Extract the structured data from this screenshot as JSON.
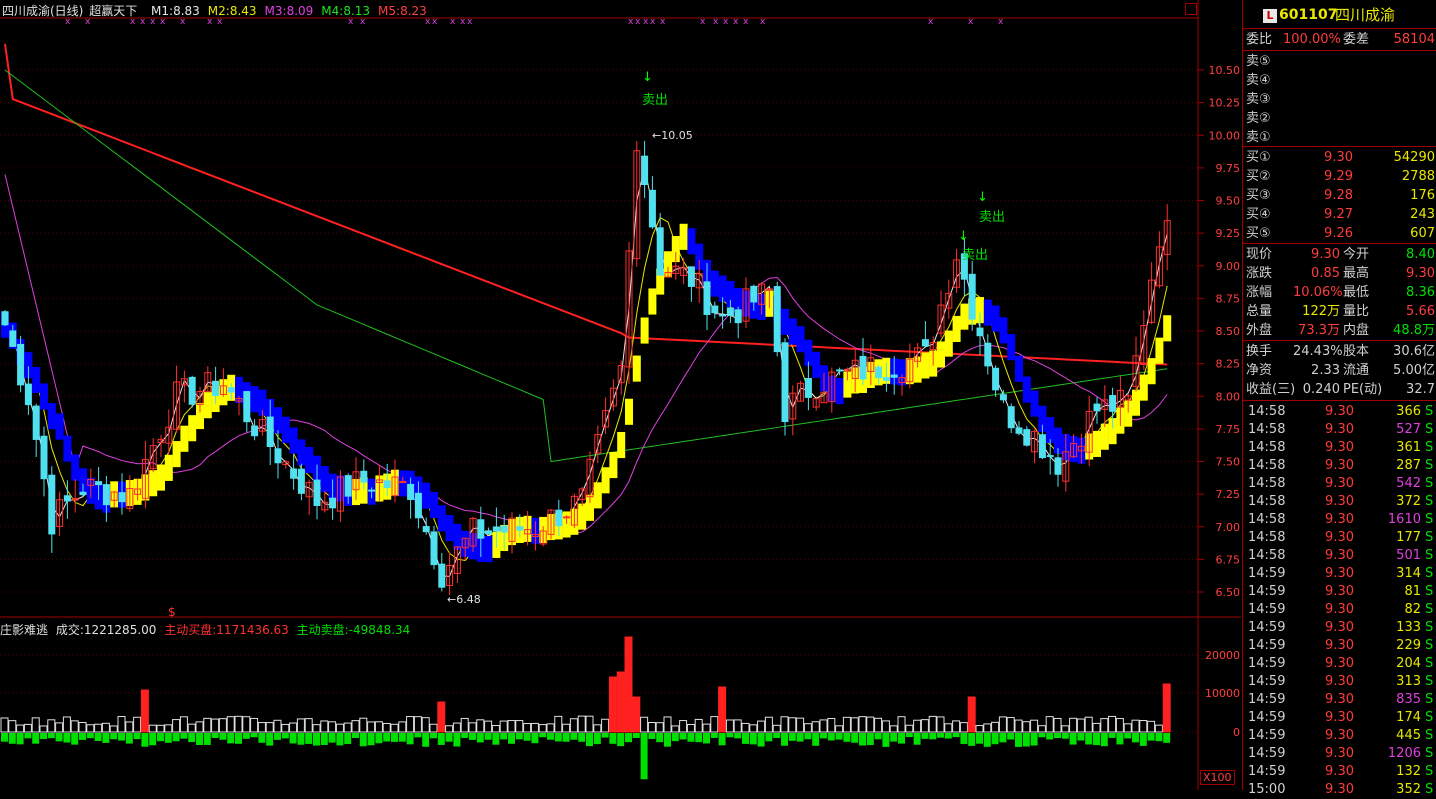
{
  "header": {
    "title": "四川成渝(日线)",
    "indicator": "超赢天下",
    "ma": [
      {
        "label": "M1:8.83",
        "color": "#e8e8e8"
      },
      {
        "label": "M2:8.43",
        "color": "#e8e800"
      },
      {
        "label": "M3:8.09",
        "color": "#e040e0"
      },
      {
        "label": "M4:8.13",
        "color": "#20e020"
      },
      {
        "label": "M5:8.23",
        "color": "#ff4040"
      }
    ]
  },
  "price_axis": [
    "10.50",
    "10.25",
    "10.00",
    "9.75",
    "9.50",
    "9.25",
    "9.00",
    "8.75",
    "8.50",
    "8.25",
    "8.00",
    "7.75",
    "7.50",
    "7.25",
    "7.00",
    "6.75",
    "6.50"
  ],
  "annotations": {
    "high": "10.05",
    "low": "6.48",
    "sell1": "卖出",
    "sell2": "卖出",
    "sell3": "卖出",
    "dollar": "$"
  },
  "volume_panel": {
    "title": "庄影难逃",
    "volume": "成交:1221285.00",
    "buy": "主动买盘:1171436.63",
    "sell": "主动卖盘:-49848.34",
    "axis": [
      "20000",
      "10000",
      "0"
    ],
    "scale": "X100"
  },
  "quote": {
    "code": "601107",
    "name": "四川成渝",
    "badge": "L",
    "weibi_label": "委比",
    "weibi": "100.00%",
    "weicha_label": "委差",
    "weicha": "58104",
    "sells": [
      {
        "label": "卖⑤"
      },
      {
        "label": "卖④"
      },
      {
        "label": "卖③"
      },
      {
        "label": "卖②"
      },
      {
        "label": "卖①"
      }
    ],
    "buys": [
      {
        "label": "买①",
        "price": "9.30",
        "vol": "54290"
      },
      {
        "label": "买②",
        "price": "9.29",
        "vol": "2788"
      },
      {
        "label": "买③",
        "price": "9.28",
        "vol": "176"
      },
      {
        "label": "买④",
        "price": "9.27",
        "vol": "243"
      },
      {
        "label": "买⑤",
        "price": "9.26",
        "vol": "607"
      }
    ],
    "stats": [
      {
        "l1": "现价",
        "v1": "9.30",
        "c1": "red",
        "l2": "今开",
        "v2": "8.40",
        "c2": "grn"
      },
      {
        "l1": "涨跌",
        "v1": "0.85",
        "c1": "red",
        "l2": "最高",
        "v2": "9.30",
        "c2": "red"
      },
      {
        "l1": "涨幅",
        "v1": "10.06%",
        "c1": "red",
        "l2": "最低",
        "v2": "8.36",
        "c2": "grn"
      },
      {
        "l1": "总量",
        "v1": "122万",
        "c1": "yel",
        "l2": "量比",
        "v2": "5.66",
        "c2": "red"
      },
      {
        "l1": "外盘",
        "v1": "73.3万",
        "c1": "red",
        "l2": "内盘",
        "v2": "48.8万",
        "c2": "grn"
      }
    ],
    "stats2": [
      {
        "l1": "换手",
        "v1": "24.43%",
        "l2": "股本",
        "v2": "30.6亿"
      },
      {
        "l1": "净资",
        "v1": "2.33",
        "l2": "流通",
        "v2": "5.00亿"
      },
      {
        "l1": "收益(三)",
        "v1": "0.240",
        "l2": "PE(动)",
        "v2": "32.7"
      }
    ],
    "ticks": [
      {
        "t": "14:58",
        "p": "9.30",
        "v": "366",
        "c": "yel"
      },
      {
        "t": "14:58",
        "p": "9.30",
        "v": "527",
        "c": "mag"
      },
      {
        "t": "14:58",
        "p": "9.30",
        "v": "361",
        "c": "yel"
      },
      {
        "t": "14:58",
        "p": "9.30",
        "v": "287",
        "c": "yel"
      },
      {
        "t": "14:58",
        "p": "9.30",
        "v": "542",
        "c": "mag"
      },
      {
        "t": "14:58",
        "p": "9.30",
        "v": "372",
        "c": "yel"
      },
      {
        "t": "14:58",
        "p": "9.30",
        "v": "1610",
        "c": "mag"
      },
      {
        "t": "14:58",
        "p": "9.30",
        "v": "177",
        "c": "yel"
      },
      {
        "t": "14:58",
        "p": "9.30",
        "v": "501",
        "c": "mag"
      },
      {
        "t": "14:59",
        "p": "9.30",
        "v": "314",
        "c": "yel"
      },
      {
        "t": "14:59",
        "p": "9.30",
        "v": "81",
        "c": "yel"
      },
      {
        "t": "14:59",
        "p": "9.30",
        "v": "82",
        "c": "yel"
      },
      {
        "t": "14:59",
        "p": "9.30",
        "v": "133",
        "c": "yel"
      },
      {
        "t": "14:59",
        "p": "9.30",
        "v": "229",
        "c": "yel"
      },
      {
        "t": "14:59",
        "p": "9.30",
        "v": "204",
        "c": "yel"
      },
      {
        "t": "14:59",
        "p": "9.30",
        "v": "313",
        "c": "yel"
      },
      {
        "t": "14:59",
        "p": "9.30",
        "v": "835",
        "c": "mag"
      },
      {
        "t": "14:59",
        "p": "9.30",
        "v": "174",
        "c": "yel"
      },
      {
        "t": "14:59",
        "p": "9.30",
        "v": "445",
        "c": "yel"
      },
      {
        "t": "14:59",
        "p": "9.30",
        "v": "1206",
        "c": "mag"
      },
      {
        "t": "14:59",
        "p": "9.30",
        "v": "132",
        "c": "yel"
      },
      {
        "t": "15:00",
        "p": "9.30",
        "v": "352",
        "c": "yel"
      }
    ],
    "tick_side": "S"
  }
}
